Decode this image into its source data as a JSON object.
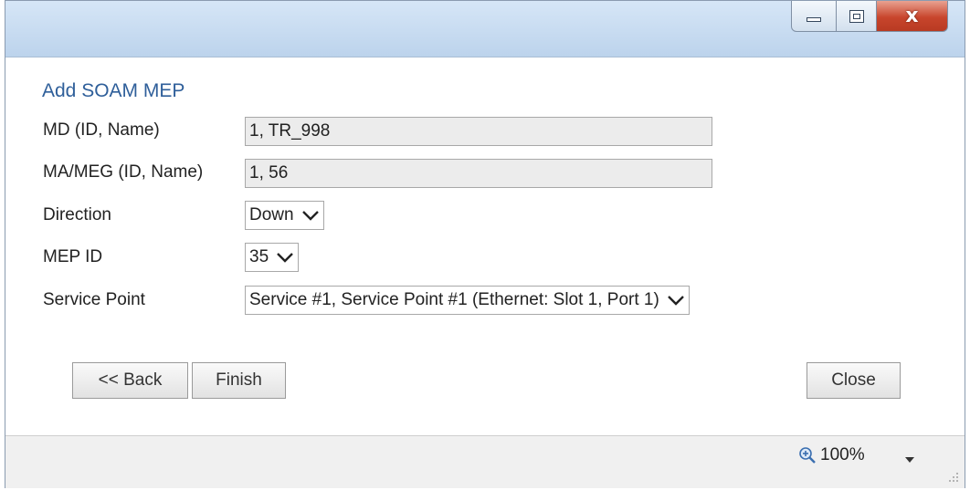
{
  "window": {
    "controls": {
      "minimize_icon": "minimize-icon",
      "maximize_icon": "maximize-icon",
      "close_glyph": "x"
    }
  },
  "dialog": {
    "title": "Add SOAM MEP",
    "fields": {
      "md_label": "MD (ID, Name)",
      "md_value": "1, TR_998",
      "ma_label": "MA/MEG (ID, Name)",
      "ma_value": "1, 56",
      "direction_label": "Direction",
      "direction_value": "Down",
      "mep_id_label": "MEP ID",
      "mep_id_value": "35",
      "service_point_label": "Service Point",
      "service_point_value": "Service #1, Service Point #1 (Ethernet: Slot 1, Port 1)"
    },
    "buttons": {
      "back": "<< Back",
      "finish": "Finish",
      "close": "Close"
    }
  },
  "statusbar": {
    "zoom": "100%"
  },
  "colors": {
    "title": "#2f5f9a",
    "titlebar": "#c9dcf1",
    "close_button": "#c8452c"
  }
}
